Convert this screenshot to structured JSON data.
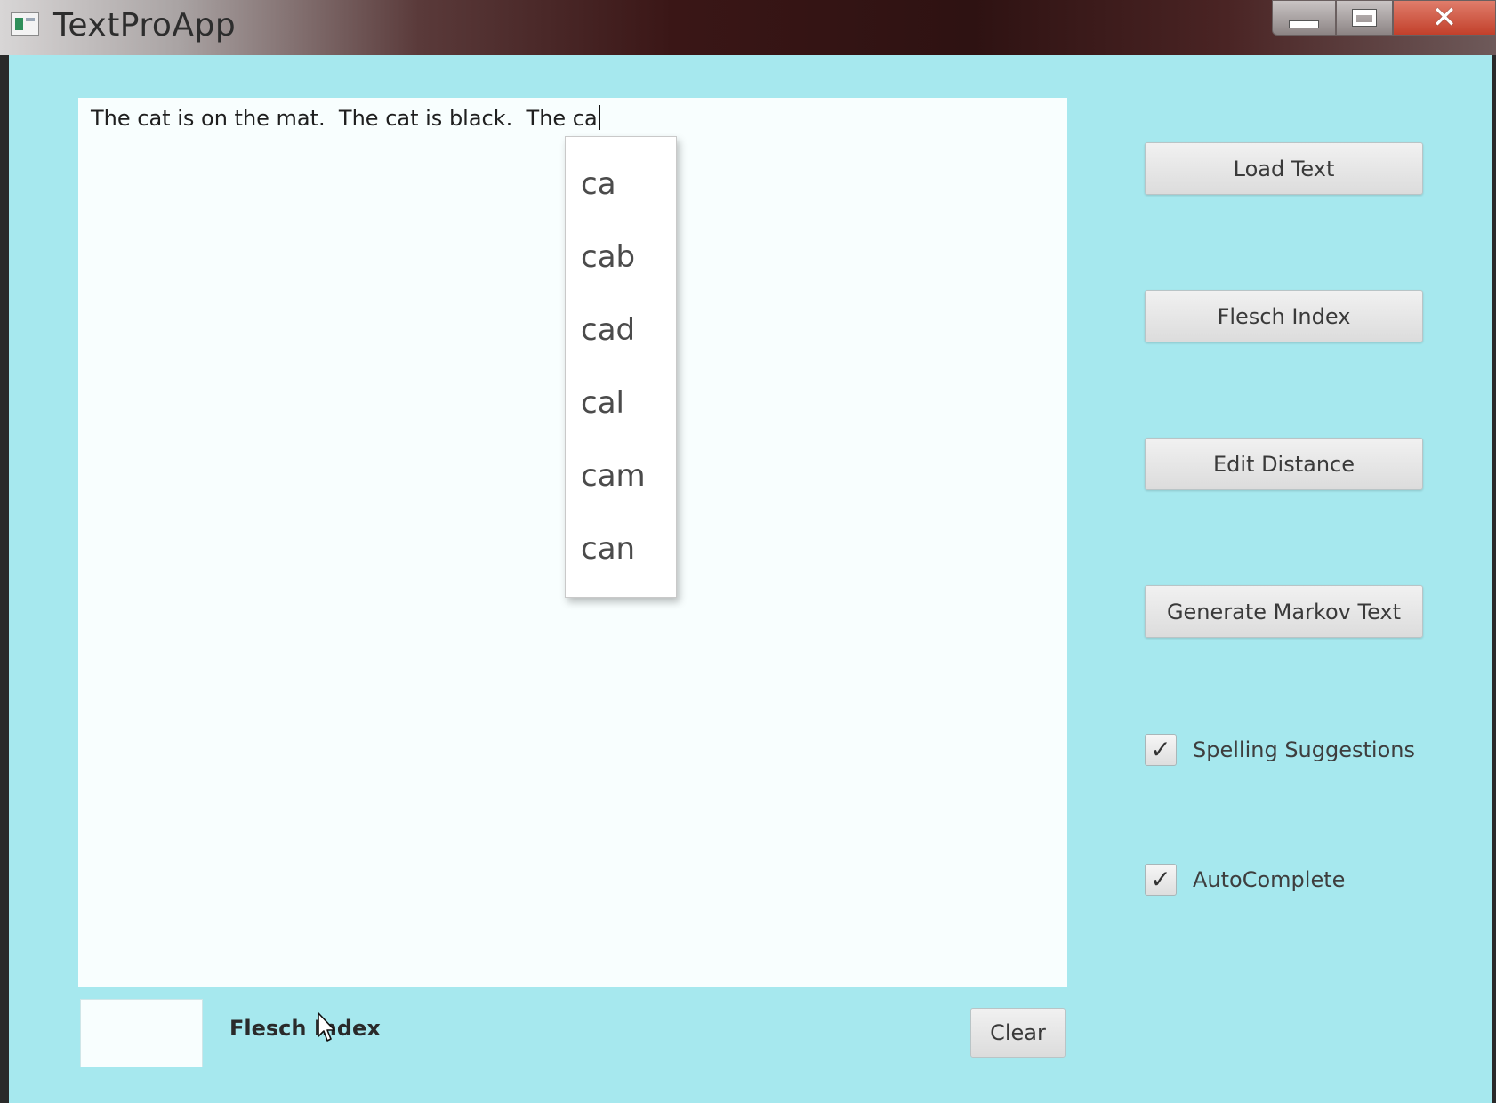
{
  "window": {
    "title": "TextProApp",
    "icon": "app-icon",
    "controls": {
      "minimize": "minimize-icon",
      "maximize": "maximize-icon",
      "close": "close-icon",
      "close_glyph": "✕"
    }
  },
  "editor": {
    "text": "The cat is on the mat.  The cat is black.  The ca"
  },
  "autocomplete": {
    "suggestions": [
      "ca",
      "cab",
      "cad",
      "cal",
      "cam",
      "can"
    ]
  },
  "sidebar": {
    "buttons": {
      "load_text": "Load Text",
      "flesch_index": "Flesch Index",
      "edit_distance": "Edit Distance",
      "generate_markov": "Generate Markov Text"
    },
    "checkboxes": {
      "spelling_suggestions": {
        "label": "Spelling Suggestions",
        "checked": true
      },
      "autocomplete": {
        "label": "AutoComplete",
        "checked": true
      }
    },
    "check_glyph": "✓"
  },
  "bottom": {
    "flesch_value": "",
    "flesch_label": "Flesch Index",
    "clear_label": "Clear"
  },
  "colors": {
    "background": "#a6e8ee",
    "editor": "#f8fefe",
    "close_button": "#c2402b"
  }
}
